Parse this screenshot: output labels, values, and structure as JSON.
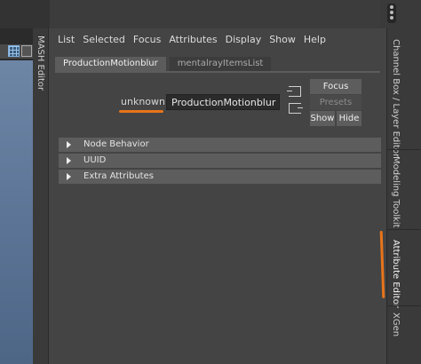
{
  "menu": [
    "List",
    "Selected",
    "Focus",
    "Attributes",
    "Display",
    "Show",
    "Help"
  ],
  "tabs": [
    {
      "label": "ProductionMotionblur",
      "active": true
    },
    {
      "label": "mentalrayItemsList",
      "active": false
    }
  ],
  "node": {
    "type_label": "unknown:",
    "name_value": "ProductionMotionblur"
  },
  "buttons": {
    "focus": "Focus",
    "presets": "Presets",
    "show": "Show",
    "hide": "Hide"
  },
  "sections": [
    "Node Behavior",
    "UUID",
    "Extra Attributes"
  ],
  "left_tab": "MASH Editor",
  "right_tabs": [
    "Channel Box / Layer Editor",
    "Modeling Toolkit",
    "Attribute Editor",
    "XGen"
  ],
  "colors": {
    "accent_annotation": "#e8741a",
    "panel_bg": "#444444",
    "section_bar": "#5d5d5d",
    "viewport": "#6e86a6"
  },
  "icons": [
    "grid-icon",
    "input-connection-icon",
    "output-connection-icon",
    "expand-triangle-icon"
  ]
}
